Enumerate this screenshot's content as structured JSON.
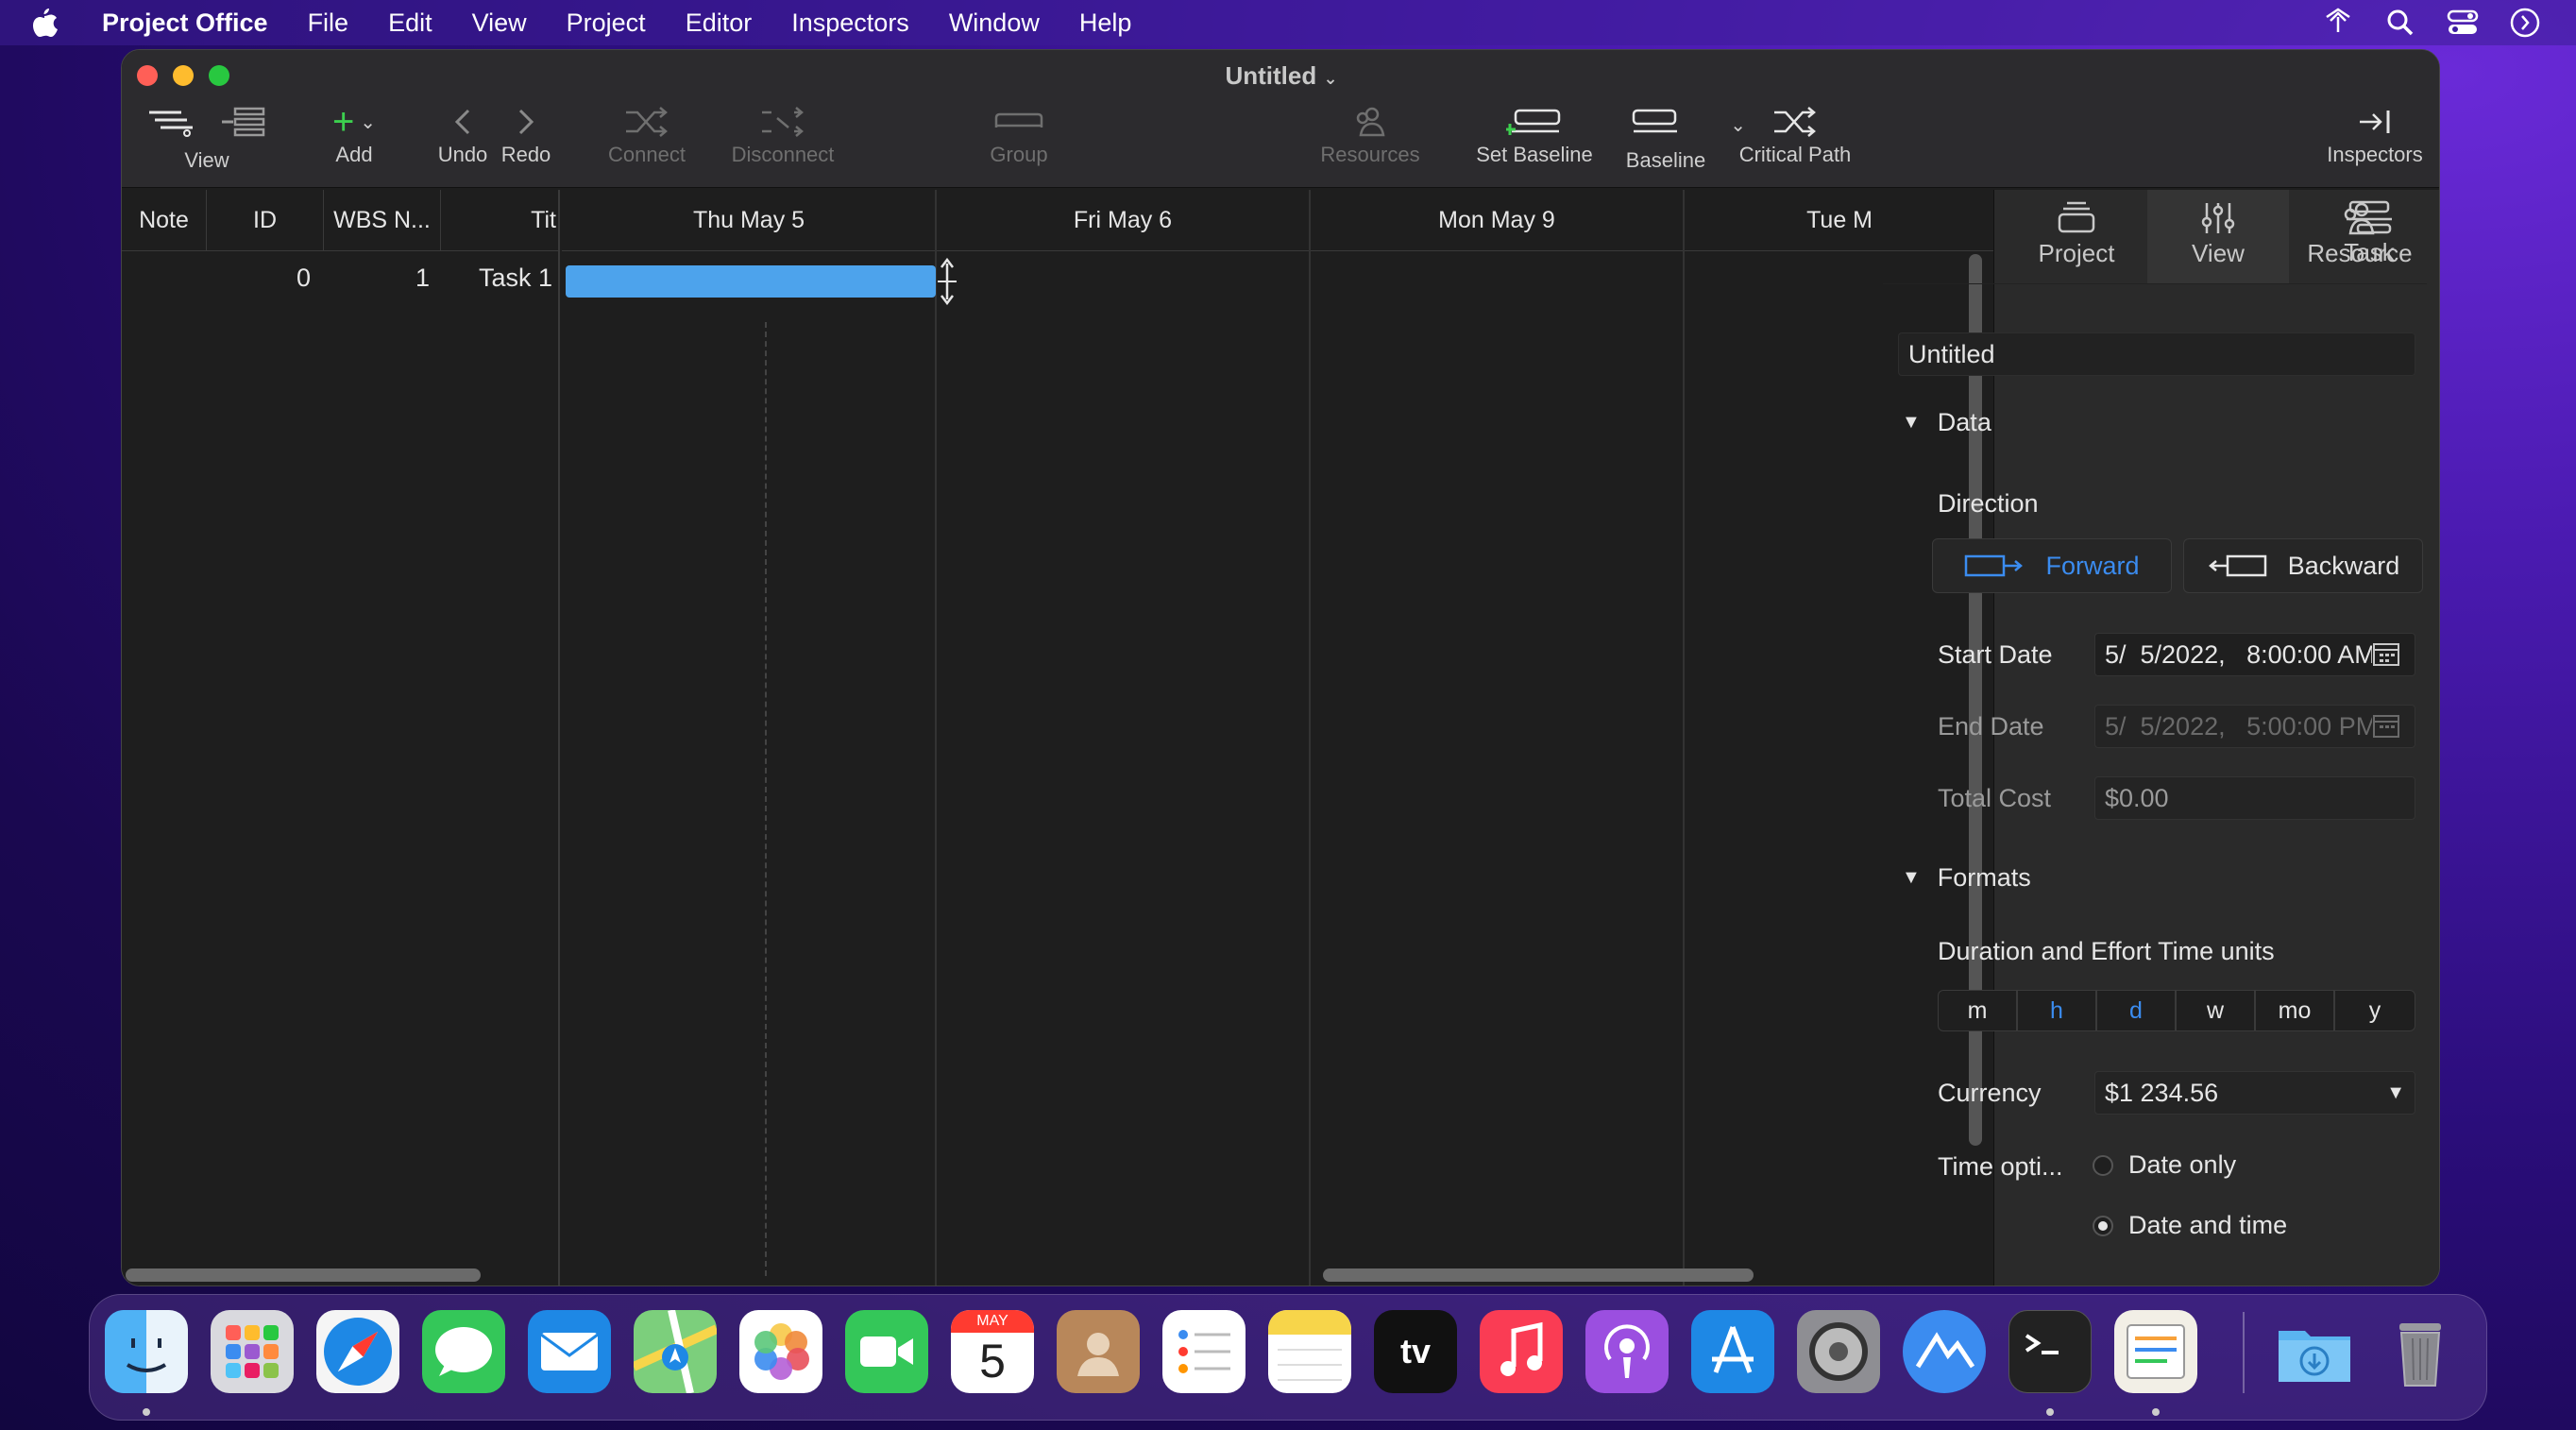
{
  "menubar": {
    "apple": "",
    "app": "Project Office",
    "items": [
      "File",
      "Edit",
      "View",
      "Project",
      "Editor",
      "Inspectors",
      "Window",
      "Help"
    ]
  },
  "window": {
    "title": "Untitled",
    "toolbar": {
      "view": "View",
      "add": "Add",
      "undo": "Undo",
      "redo": "Redo",
      "connect": "Connect",
      "disconnect": "Disconnect",
      "group": "Group",
      "resources": "Resources",
      "set_baseline": "Set Baseline",
      "baseline": "Baseline",
      "critical_path": "Critical Path",
      "inspectors": "Inspectors"
    },
    "table": {
      "columns": [
        "Note",
        "ID",
        "WBS N...",
        "Tit"
      ],
      "rows": [
        {
          "note": "",
          "id": "0",
          "wbs": "1",
          "title": "Task 1"
        }
      ]
    },
    "gantt": {
      "dates": [
        "Thu May 5",
        "Fri May 6",
        "Mon May 9",
        "Tue M"
      ],
      "bar_color": "#4da3ec"
    },
    "inspector": {
      "tabs": [
        "Project",
        "View",
        "Resource",
        "Task"
      ],
      "project_name": "Untitled",
      "data_section": "Data",
      "direction_label": "Direction",
      "forward": "Forward",
      "backward": "Backward",
      "start_date_label": "Start Date",
      "start_date_value": "5/  5/2022,   8:00:00 AM",
      "end_date_label": "End Date",
      "end_date_value": "5/  5/2022,   5:00:00 PM",
      "total_cost_label": "Total Cost",
      "total_cost_value": "$0.00",
      "formats_section": "Formats",
      "time_units_label": "Duration and Effort Time units",
      "time_units": [
        "m",
        "h",
        "d",
        "w",
        "mo",
        "y"
      ],
      "currency_label": "Currency",
      "currency_value": "$1 234.56",
      "time_option_label": "Time opti...",
      "time_options": [
        "Date only",
        "Date and time"
      ],
      "accent": "#3b8cf0"
    }
  },
  "dock": {
    "calendar_month": "MAY",
    "calendar_day": "5"
  }
}
